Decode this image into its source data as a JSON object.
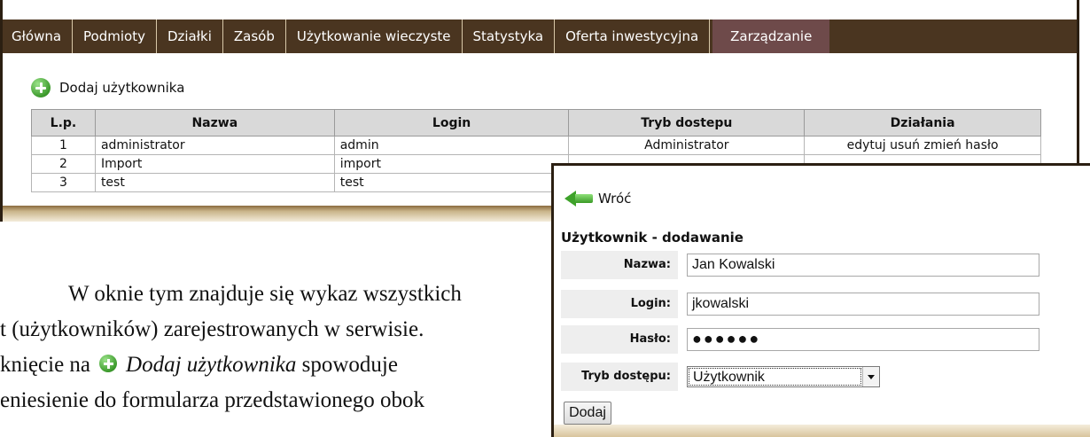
{
  "nav": {
    "tabs": [
      {
        "label": "Główna"
      },
      {
        "label": "Podmioty"
      },
      {
        "label": "Działki"
      },
      {
        "label": "Zasób"
      },
      {
        "label": "Użytkowanie wieczyste"
      },
      {
        "label": "Statystyka"
      },
      {
        "label": "Oferta inwestycyjna"
      },
      {
        "label": "Zarządzanie",
        "active": true
      }
    ]
  },
  "users_panel": {
    "add_user_label": "Dodaj użytkownika",
    "columns": [
      "L.p.",
      "Nazwa",
      "Login",
      "Tryb dostepu",
      "Działania"
    ],
    "rows": [
      {
        "lp": "1",
        "name": "administrator",
        "login": "admin",
        "access": "Administrator",
        "actions": {
          "edit": "edytuj",
          "delete": "usuń",
          "change_password": "zmień hasło"
        }
      },
      {
        "lp": "2",
        "name": "Import",
        "login": "import"
      },
      {
        "lp": "3",
        "name": "test",
        "login": "test"
      }
    ]
  },
  "document": {
    "line1": "W oknie tym znajduje się wykaz wszystkich",
    "line2": "t (użytkowników) zarejestrowanych w serwisie.",
    "line3_prefix": "knięcie na",
    "line3_link": "Dodaj użytkownika",
    "line3_suffix": "spowoduje",
    "line4": "eniesienie do formularza przedstawionego obok"
  },
  "form_panel": {
    "back_label": "Wróć",
    "title": "Użytkownik - dodawanie",
    "fields": {
      "name": {
        "label": "Nazwa:",
        "value": "Jan Kowalski"
      },
      "login": {
        "label": "Login:",
        "value": "jkowalski"
      },
      "password": {
        "label": "Hasło:",
        "value": "●●●●●●"
      },
      "access": {
        "label": "Tryb dostępu:",
        "value": "Użytkownik"
      }
    },
    "submit_label": "Dodaj"
  }
}
